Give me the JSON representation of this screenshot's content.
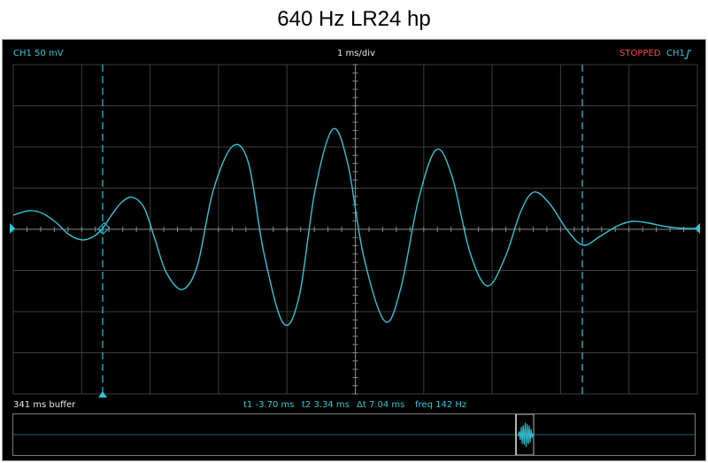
{
  "title": "640 Hz LR24 hp",
  "scope": {
    "channel_label": "CH1  50 mV",
    "timebase": "1 ms/div",
    "status": "STOPPED",
    "trigger_channel": "CH1",
    "trigger_slope_icon": "rising-edge-icon",
    "buffer": "341 ms buffer",
    "cursors": {
      "t1": "t1  -3.70 ms",
      "t2": "t2  3.34 ms",
      "delta": "Δt  7.04 ms",
      "freq": "freq  142 Hz"
    }
  },
  "colors": {
    "trace": "#35c4d4",
    "grid": "#4a4a4a",
    "background": "#000000",
    "status": "#ff4848"
  }
}
